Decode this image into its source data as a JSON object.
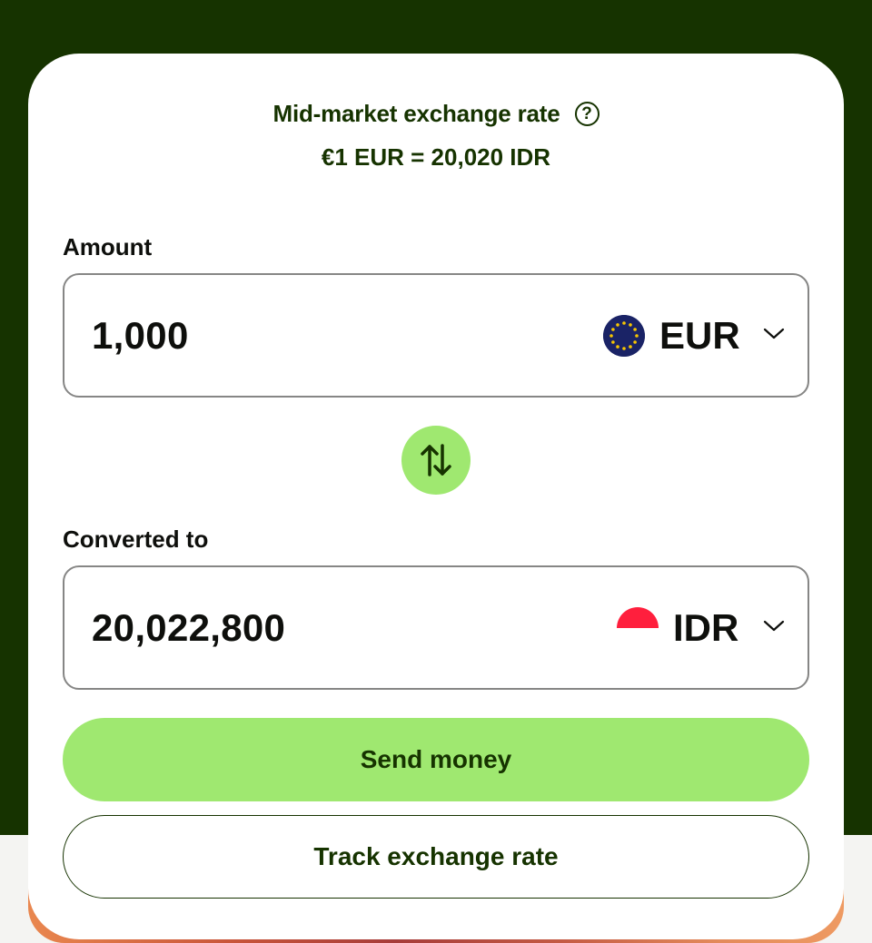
{
  "converter": {
    "rate_title": "Mid-market exchange rate",
    "help_icon": "question-mark-circle-icon",
    "rate_text": "€1 EUR = 20,020 IDR",
    "amount_label": "Amount",
    "amount_value": "1,000",
    "from_currency": {
      "code": "EUR",
      "flag_icon": "eu-flag-icon"
    },
    "swap_icon": "swap-arrows-icon",
    "converted_label": "Converted to",
    "converted_value": "20,022,800",
    "to_currency": {
      "code": "IDR",
      "flag_icon": "indonesia-flag-icon"
    },
    "send_button": "Send money",
    "track_button": "Track exchange rate"
  },
  "colors": {
    "background_dark": "#163300",
    "accent_green": "#9fe870",
    "text_dark": "#0e0f0c",
    "card_background": "#ffffff"
  }
}
